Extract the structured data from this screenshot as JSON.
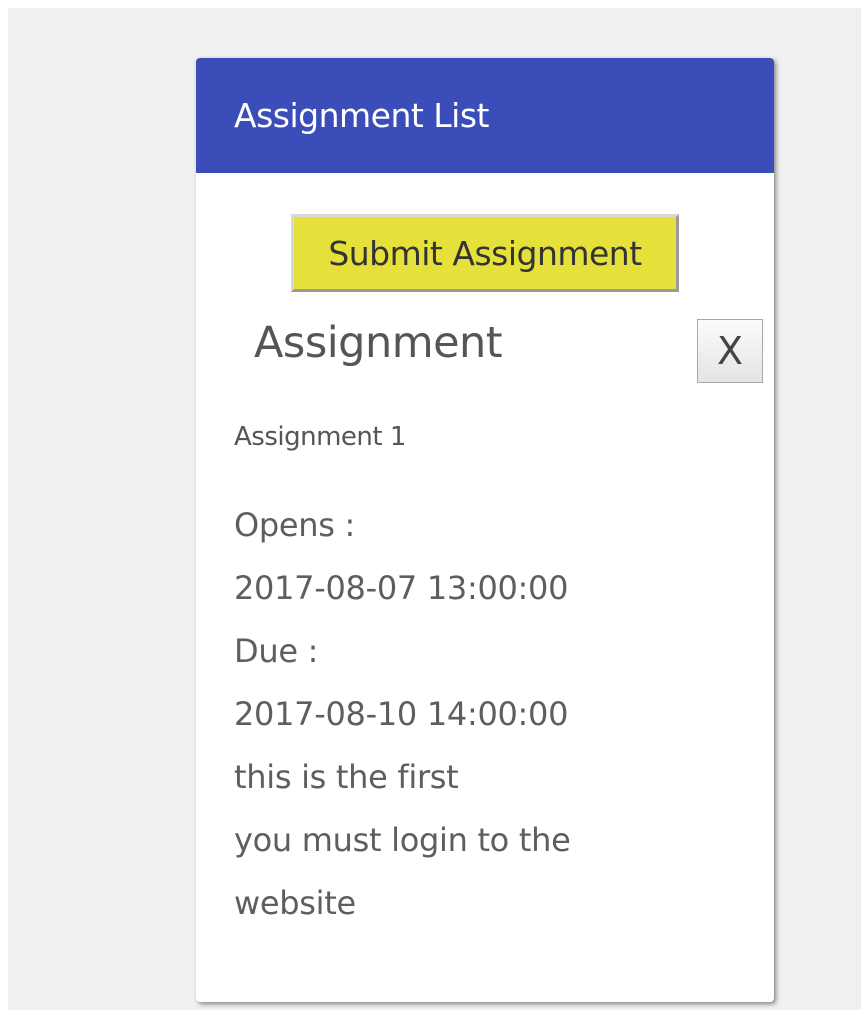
{
  "card": {
    "title": "Assignment List",
    "header_color": "#3b4db8"
  },
  "submit_button": {
    "label": "Submit Assignment",
    "color": "#e6e13a"
  },
  "assignment_panel": {
    "heading": "Assignment",
    "close_label": "X",
    "name": "Assignment 1",
    "opens_label": "Opens :",
    "opens_value": "2017-08-07 13:00:00",
    "due_label": "Due :",
    "due_value": "2017-08-10 14:00:00",
    "description_lines": [
      "this is the first",
      "you must login to the",
      "website"
    ]
  }
}
